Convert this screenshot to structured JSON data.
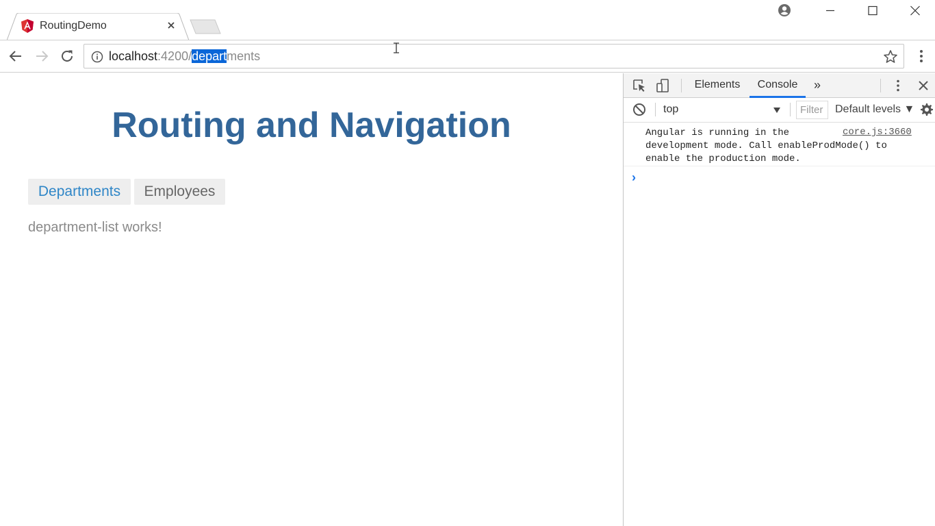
{
  "browser": {
    "tab_title": "RoutingDemo",
    "url": {
      "host": "localhost",
      "port": ":4200/",
      "path_selected": "depart",
      "path_rest": "ments"
    }
  },
  "page": {
    "heading": "Routing and Navigation",
    "nav": {
      "departments": "Departments",
      "employees": "Employees"
    },
    "content": "department-list works!"
  },
  "devtools": {
    "tabs": {
      "elements": "Elements",
      "console": "Console",
      "more": "»"
    },
    "context": "top",
    "filter_placeholder": "Filter",
    "levels": "Default levels ▼",
    "message": "Angular is running in the\ndevelopment mode. Call enableProdMode() to\nenable the production mode.",
    "message_source": "core.js:3660",
    "prompt": "›"
  },
  "colors": {
    "heading": "#336699",
    "active_nav": "#2f86c7",
    "accent": "#1a73e8",
    "selection": "#0a66d8"
  },
  "icons": [
    "angular-favicon",
    "close-icon",
    "profile-icon",
    "minimize-icon",
    "maximize-icon",
    "window-close-icon",
    "back-icon",
    "forward-icon",
    "reload-icon",
    "info-icon",
    "star-icon",
    "menu-dots-icon",
    "inspect-icon",
    "device-toolbar-icon",
    "clear-console-icon",
    "gear-icon"
  ]
}
